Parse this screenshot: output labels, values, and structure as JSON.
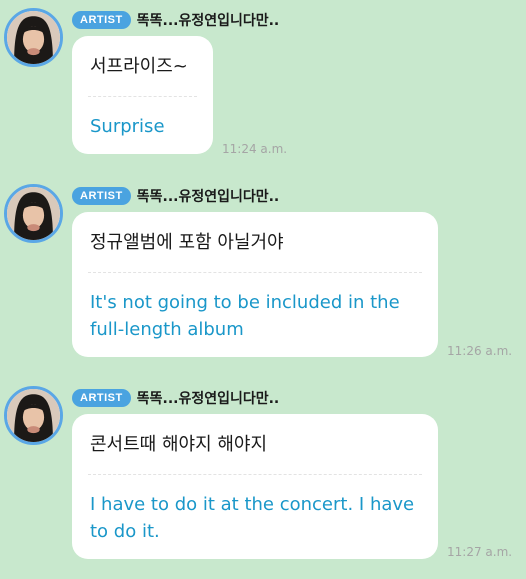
{
  "messages": [
    {
      "badge": "ARTIST",
      "sender": "똑똑...유정연입니다만..",
      "korean": "서프라이즈~",
      "translation": "Surprise",
      "time": "11:24 a.m."
    },
    {
      "badge": "ARTIST",
      "sender": "똑똑...유정연입니다만..",
      "korean": "정규앨범에 포함 아닐거야",
      "translation": "It's not going to be included in the full-length album",
      "time": "11:26 a.m."
    },
    {
      "badge": "ARTIST",
      "sender": "똑똑...유정연입니다만..",
      "korean": "콘서트때 해야지 해야지",
      "translation": "I have to do it at the concert. I have to do it.",
      "time": "11:27 a.m."
    }
  ],
  "colors": {
    "background": "#c8e8cd",
    "badge": "#4aa3e0",
    "translation_text": "#1a97c9",
    "avatar_ring": "#5aa7e6"
  }
}
